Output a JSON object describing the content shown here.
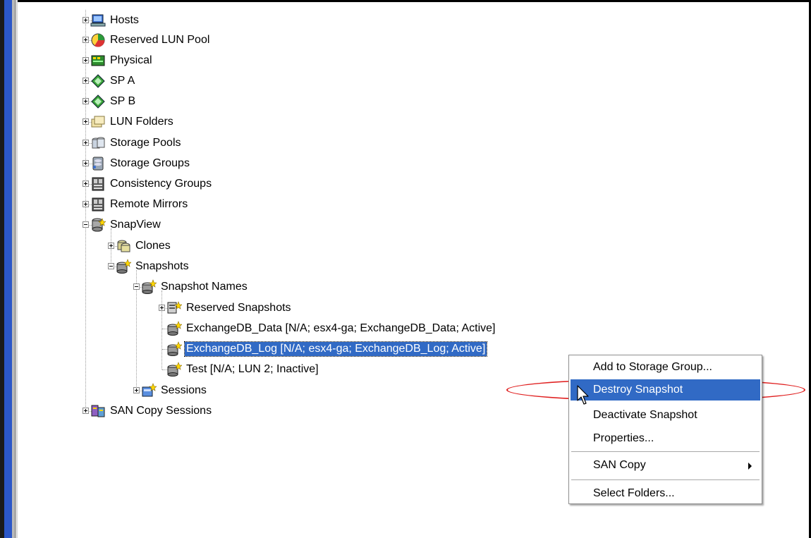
{
  "tree": {
    "items": [
      {
        "label": "Hosts",
        "icon": "hosts-icon",
        "expander": "plus"
      },
      {
        "label": "Reserved LUN Pool",
        "icon": "reserved-lun-pool-icon",
        "expander": "plus"
      },
      {
        "label": "Physical",
        "icon": "physical-icon",
        "expander": "plus"
      },
      {
        "label": "SP A",
        "icon": "storage-processor-icon",
        "expander": "plus"
      },
      {
        "label": "SP B",
        "icon": "storage-processor-icon",
        "expander": "plus"
      },
      {
        "label": "LUN Folders",
        "icon": "folders-icon",
        "expander": "plus"
      },
      {
        "label": "Storage Pools",
        "icon": "storage-pools-icon",
        "expander": "plus"
      },
      {
        "label": "Storage Groups",
        "icon": "storage-groups-icon",
        "expander": "plus"
      },
      {
        "label": "Consistency Groups",
        "icon": "consistency-groups-icon",
        "expander": "plus"
      },
      {
        "label": "Remote Mirrors",
        "icon": "remote-mirrors-icon",
        "expander": "plus"
      },
      {
        "label": "SnapView",
        "icon": "snapview-icon",
        "expander": "minus"
      },
      {
        "label": "Clones",
        "icon": "clones-icon",
        "expander": "plus"
      },
      {
        "label": "Snapshots",
        "icon": "snapshot-icon",
        "expander": "minus"
      },
      {
        "label": "Snapshot Names",
        "icon": "snapshot-icon",
        "expander": "minus"
      },
      {
        "label": "Reserved Snapshots",
        "icon": "reserved-snapshots-icon",
        "expander": "plus"
      },
      {
        "label": "ExchangeDB_Data [N/A; esx4-ga; ExchangeDB_Data; Active]",
        "icon": "snapshot-icon",
        "expander": "none"
      },
      {
        "label": "ExchangeDB_Log [N/A; esx4-ga; ExchangeDB_Log; Active]",
        "icon": "snapshot-icon",
        "expander": "none",
        "selected": true
      },
      {
        "label": "Test [N/A; LUN 2; Inactive]",
        "icon": "snapshot-icon",
        "expander": "none"
      },
      {
        "label": "Sessions",
        "icon": "sessions-icon",
        "expander": "plus"
      },
      {
        "label": "SAN Copy Sessions",
        "icon": "san-copy-sessions-icon",
        "expander": "plus"
      }
    ]
  },
  "context_menu": {
    "items": [
      {
        "label": "Add to Storage Group..."
      },
      {
        "label": "Destroy Snapshot",
        "highlighted": true
      },
      {
        "label": "Deactivate Snapshot"
      },
      {
        "label": "Properties..."
      },
      {
        "label": "SAN Copy",
        "submenu": true
      },
      {
        "label": "Select Folders..."
      }
    ]
  },
  "colors": {
    "selection": "#316ac5",
    "annotation_oval": "#e02020",
    "left_edge_blue": "#2b57c8"
  }
}
